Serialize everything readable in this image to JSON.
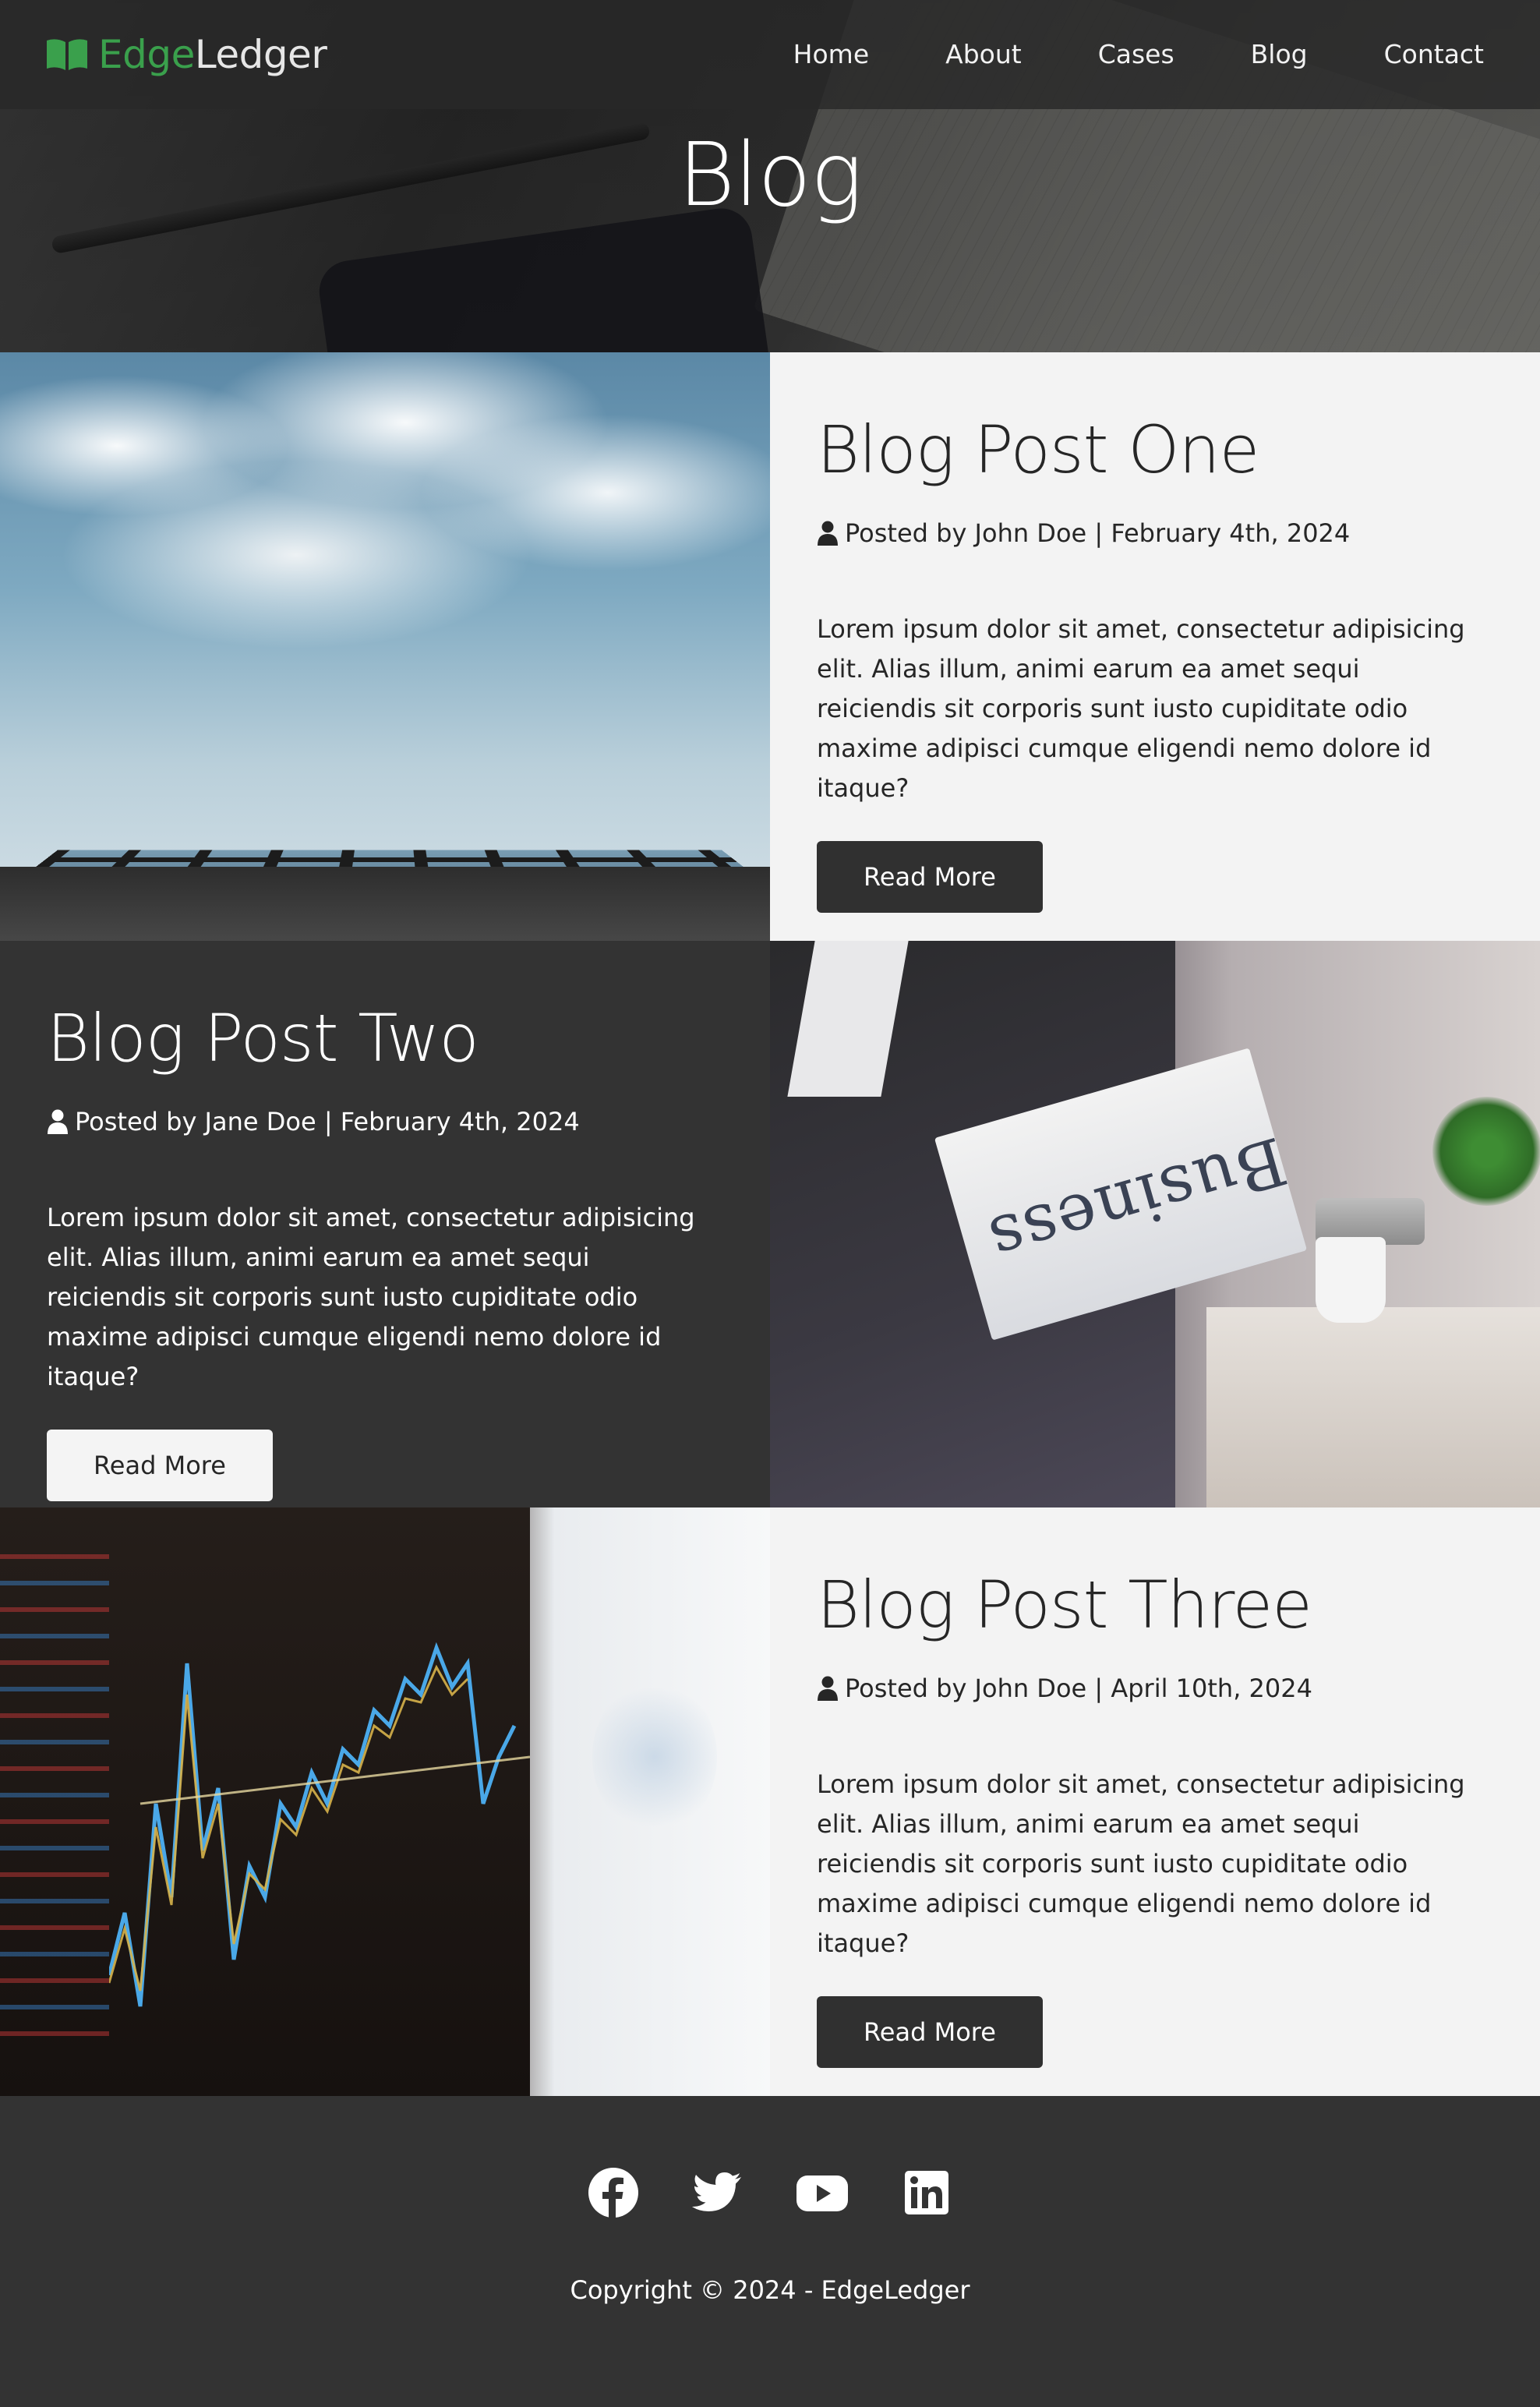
{
  "brand": {
    "part1": "Edge",
    "part2": "Ledger",
    "accent_color": "#3aa04c",
    "icon": "book-open-icon"
  },
  "nav": {
    "items": [
      {
        "label": "Home"
      },
      {
        "label": "About"
      },
      {
        "label": "Cases"
      },
      {
        "label": "Blog"
      },
      {
        "label": "Contact"
      }
    ]
  },
  "hero": {
    "title": "Blog"
  },
  "posts": [
    {
      "title": "Blog Post One",
      "meta": "Posted by John Doe | February 4th, 2024",
      "body": "Lorem ipsum dolor sit amet, consectetur adipisicing elit. Alias illum, animi earum ea amet sequi reiciendis sit corporis sunt iusto cupiditate odio maxime adipisci cumque eligendi nemo dolore id itaque?",
      "button": "Read More",
      "image": "building-sky-photo"
    },
    {
      "title": "Blog Post Two",
      "meta": "Posted by Jane Doe | February 4th, 2024",
      "body": "Lorem ipsum dolor sit amet, consectetur adipisicing elit. Alias illum, animi earum ea amet sequi reiciendis sit corporis sunt iusto cupiditate odio maxime adipisci cumque eligendi nemo dolore id itaque?",
      "button": "Read More",
      "image": "business-newspaper-photo",
      "image_text": "Business"
    },
    {
      "title": "Blog Post Three",
      "meta": "Posted by John Doe | April 10th, 2024",
      "body": "Lorem ipsum dolor sit amet, consectetur adipisicing elit. Alias illum, animi earum ea amet sequi reiciendis sit corporis sunt iusto cupiditate odio maxime adipisci cumque eligendi nemo dolore id itaque?",
      "button": "Read More",
      "image": "stock-chart-photo"
    }
  ],
  "footer": {
    "socials": [
      {
        "icon": "facebook-icon"
      },
      {
        "icon": "twitter-icon"
      },
      {
        "icon": "youtube-icon"
      },
      {
        "icon": "linkedin-icon"
      }
    ],
    "copyright": "Copyright © 2024 - EdgeLedger"
  }
}
